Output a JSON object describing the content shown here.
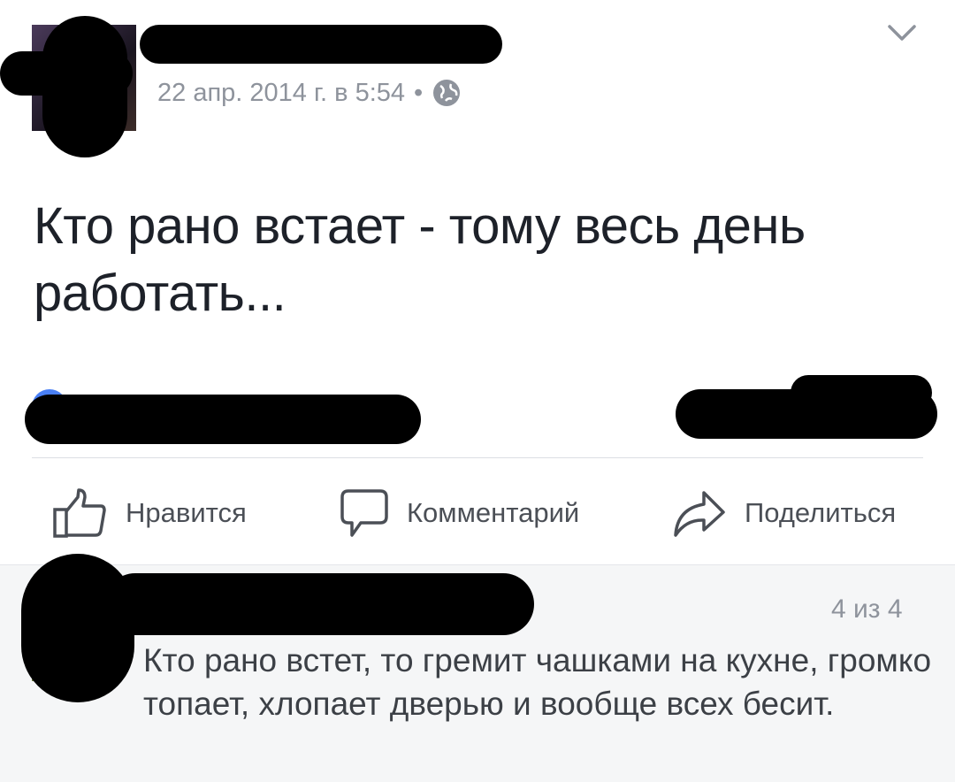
{
  "post": {
    "timestamp": "22 апр. 2014 г. в 5:54",
    "separator": "•",
    "privacy_icon": "globe-icon",
    "menu_icon": "chevron-down-icon",
    "text": "Кто рано встает - тому весь день работать..."
  },
  "actions": {
    "like_label": "Нравится",
    "comment_label": "Комментарий",
    "share_label": "Поделиться"
  },
  "comment": {
    "counter": "4 из 4",
    "text": "Кто рано встет, то гремит чашками на кухне, громко топает, хлопает дверью и вообще всех бесит."
  },
  "colors": {
    "text_primary": "#1d2129",
    "text_secondary": "#8e939c",
    "action_gray": "#4b4f56",
    "reaction_blue": "#4a80f5",
    "comment_bg": "#f5f6f7"
  }
}
